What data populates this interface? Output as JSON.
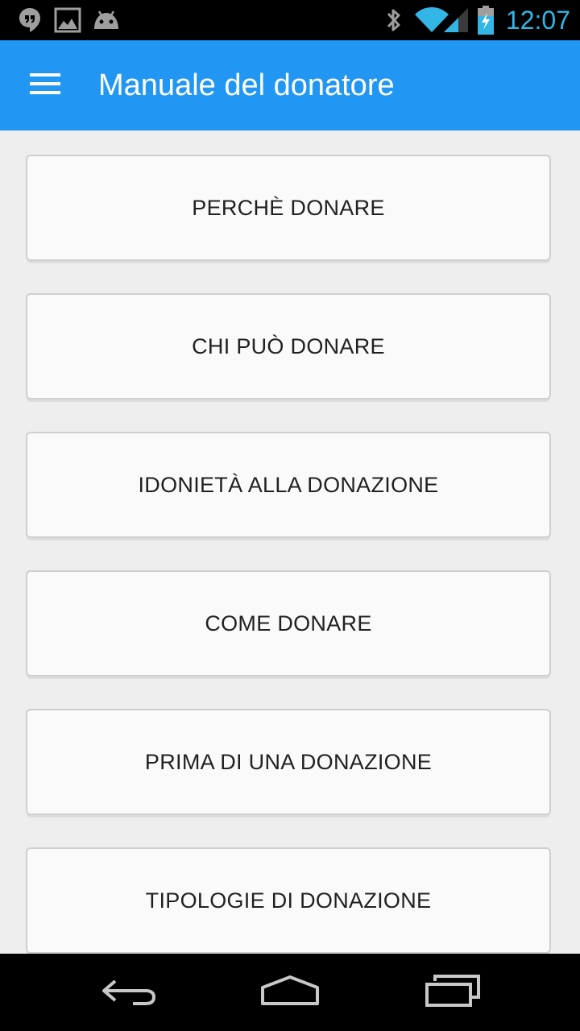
{
  "status_bar": {
    "time": "12:07",
    "icons": [
      "hangouts-icon",
      "image-icon",
      "android-icon",
      "bluetooth-icon",
      "wifi-icon",
      "signal-icon",
      "battery-charging-icon"
    ],
    "clock_color": "#33b5e5"
  },
  "app_bar": {
    "title": "Manuale del donatore",
    "menu_icon": "hamburger-menu-icon",
    "color": "#2196f3"
  },
  "menu_items": [
    {
      "label": "PERCHÈ DONARE"
    },
    {
      "label": "CHI PUÒ DONARE"
    },
    {
      "label": "IDONIETÀ ALLA DONAZIONE"
    },
    {
      "label": "COME DONARE"
    },
    {
      "label": "PRIMA DI UNA DONAZIONE"
    },
    {
      "label": "TIPOLOGIE DI DONAZIONE"
    }
  ],
  "nav_bar": {
    "icons": [
      "back-icon",
      "home-icon",
      "recent-apps-icon"
    ]
  }
}
